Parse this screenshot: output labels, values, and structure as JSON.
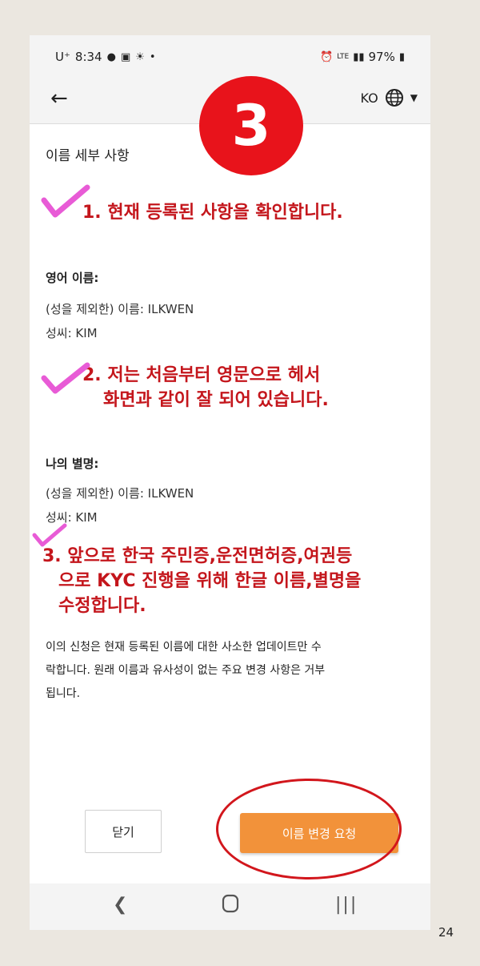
{
  "status": {
    "carrier": "U⁺",
    "time": "8:34",
    "network": "LTE",
    "battery": "97%"
  },
  "app_bar": {
    "language": "KO"
  },
  "step_badge": "3",
  "section_title": "이름 세부 사항",
  "annotations": {
    "note1": "1. 현재 등록된 사항을 확인합니다.",
    "note2_line1": "2. 저는 처음부터 영문으로 헤서",
    "note2_line2": "화면과 같이 잘 되어 있습니다.",
    "note3_line1": "3. 앞으로 한국 주민증,운전면허증,여권등",
    "note3_line2": "으로 KYC 진행을 위해 한글 이름,별명을",
    "note3_line3": "수정합니다."
  },
  "english_name": {
    "label": "영어 이름:",
    "first_name": "(성을 제외한) 이름: ILKWEN",
    "last_name": "성씨: KIM"
  },
  "nickname": {
    "label": "나의 별명:",
    "first_name": "(성을 제외한) 이름: ILKWEN",
    "last_name": "성씨: KIM"
  },
  "notice": {
    "line1": "이의 신청은 현재 등록된 이름에 대한 사소한 업데이트만 수",
    "line2": "락합니다. 원래 이름과 유사성이 없는 주요 변경 사항은 거부",
    "line3": "됩니다."
  },
  "buttons": {
    "close": "닫기",
    "request_change": "이름 변경 요청"
  },
  "page_number": "24",
  "colors": {
    "accent": "#f2923a",
    "annotation_red": "#c4161c",
    "checkmark_pink": "#e85bd6"
  }
}
